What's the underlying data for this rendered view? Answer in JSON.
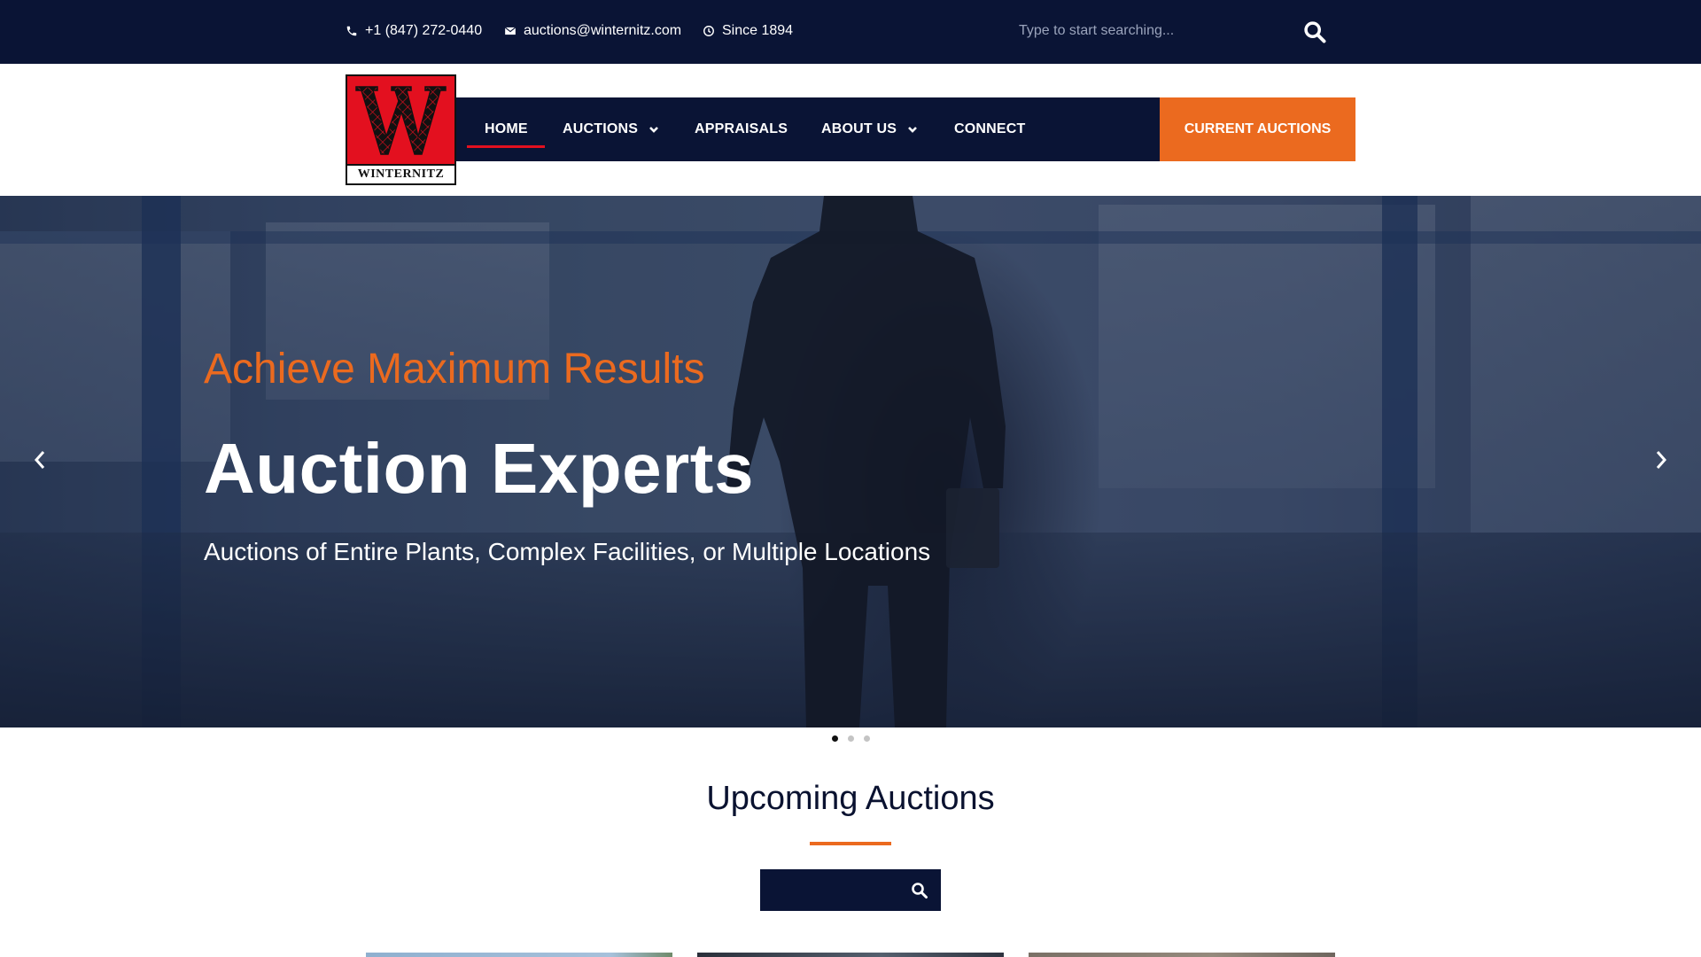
{
  "topbar": {
    "phone": "+1 (847) 272-0440",
    "email": "auctions@winternitz.com",
    "since": "Since 1894",
    "search_placeholder": "Type to start searching..."
  },
  "logo": {
    "text": "WINTERNITZ",
    "letter": "W"
  },
  "nav": {
    "items": [
      {
        "label": "HOME",
        "active": true,
        "has_dropdown": false
      },
      {
        "label": "AUCTIONS",
        "active": false,
        "has_dropdown": true
      },
      {
        "label": "APPRAISALS",
        "active": false,
        "has_dropdown": false
      },
      {
        "label": "ABOUT US",
        "active": false,
        "has_dropdown": true
      },
      {
        "label": "CONNECT",
        "active": false,
        "has_dropdown": false
      }
    ],
    "cta": "CURRENT AUCTIONS"
  },
  "hero": {
    "kicker": "Achieve Maximum Results",
    "title": "Auction Experts",
    "subtitle": "Auctions of Entire Plants, Complex Facilities, or Multiple Locations",
    "slide_count": 3,
    "active_slide": 1
  },
  "upcoming": {
    "title": "Upcoming Auctions",
    "search_placeholder": ""
  },
  "colors": {
    "navy": "#0a1435",
    "orange": "#eb6a1f",
    "logo_red": "#e3101f",
    "active_underline": "#e3101f"
  },
  "icons": [
    "phone-icon",
    "envelope-icon",
    "clock-icon",
    "search-icon",
    "chevron-down-icon",
    "chevron-left-icon",
    "chevron-right-icon"
  ]
}
